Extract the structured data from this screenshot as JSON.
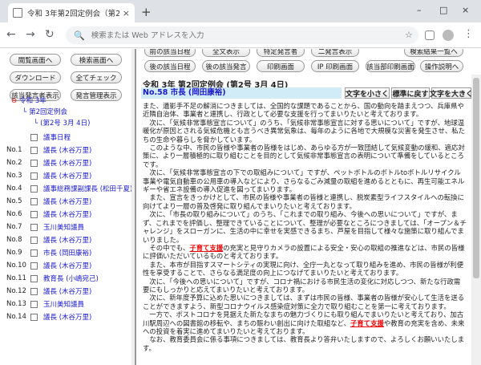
{
  "browser": {
    "tab_title": "令和 3年第2回定例会（第2号 3月",
    "close": "×",
    "newtab": "+",
    "win_min": "–",
    "win_max": "□",
    "win_close": "×",
    "back": "←",
    "forward": "→",
    "reload": "↻",
    "omni_icon": "🔍",
    "address_placeholder": "検索または Web アドレスを入力",
    "star": "☆",
    "menu": "⋮"
  },
  "left": {
    "buttons": [
      "閲覧画面へ",
      "検索画面へ",
      "ダウンロード",
      "全てチェック",
      "該当発言者表示",
      "発言管理表示"
    ],
    "tree_root": "令和 3年",
    "tree_session": "第2回定例会",
    "tree_issue": "(第2号 3月 4日)",
    "tree_line": "└",
    "tree_bullet": "⊖",
    "rows": [
      {
        "no": "",
        "label": "議事日程"
      },
      {
        "no": "No.1",
        "label": "議長 (木谷万里)"
      },
      {
        "no": "No.2",
        "label": "議長 (木谷万里)"
      },
      {
        "no": "No.3",
        "label": "議長 (木谷万里)"
      },
      {
        "no": "No.4",
        "label": "議事総務課副課長 (松田千夏)"
      },
      {
        "no": "No.5",
        "label": "議長 (木谷万里)"
      },
      {
        "no": "No.6",
        "label": "議長 (木谷万里)"
      },
      {
        "no": "No.7",
        "label": "玉川美知議員"
      },
      {
        "no": "No.8",
        "label": "議長 (木谷万里)"
      },
      {
        "no": "No.9",
        "label": "市長 (岡田康裕)"
      },
      {
        "no": "No.10",
        "label": "議長 (木谷万里)"
      },
      {
        "no": "No.11",
        "label": "教育長 (小嶋宛己)"
      },
      {
        "no": "No.12",
        "label": "議長 (木谷万里)"
      },
      {
        "no": "No.13",
        "label": "玉川美知議員"
      },
      {
        "no": "No.14",
        "label": "議長 (木谷万里)"
      }
    ]
  },
  "right": {
    "toolbar": [
      "前の該当日程",
      "全文表示",
      "特定発言者",
      "二発言表示",
      "検索結果一覧へ",
      "後の該当日程",
      "後の該当発言",
      "印刷画面",
      "IP 印刷画面",
      "該当部印刷画面",
      "操作説明へ"
    ],
    "meeting_title": "令和 3年 第2回定例会 (第2号 3月 4日)",
    "speaker": "No.58 市長 (岡田康裕)",
    "size_small": "文字を小さく",
    "size_normal": "標準に戻す",
    "size_large": "文字を大きく",
    "paragraphs": [
      "また、遺影手不足の解消につきましては、全国的な課題であることから、国の動向を踏まえつつ、兵庫県や近隣自治体、事業者と連携し、行政として必要な支援を行ってまいりたいと考えております。",
      "次に、「気候非常事態宣言について」のうち、「気候非常事態宣言に対する思いについて」ですが、地球温暖化が原因とされる気候危機とも言うべき異常気象は、毎年のように各地で大規模な災害を発生させ、私たちの生命や暮らしを脅かしています。",
      "このような中、市民の皆様や事業者の皆様をはじめ、あらゆる方が一致団結して気候変動の緩和、適応対策に、より一層積極的に取り組むことを目的として気候非常事態宣言の表明について準備をしているところです。",
      "次に、「気候非常事態宣言の下での取組みについて」ですが、ペットボトルのボトルtoボトルリサイクル事業や電気自動車の公用車の導入などにより、さらなるごみ減量の取組を進めるとともに、再生可能エネルギーや省エネ設備の導入促進を図ってまいります。",
      "また、宣言をきっかけとして、市民の皆様や事業者の皆様と連携し、脱炭素型ライフスタイルへの転換に向けてより一層の普及啓発に取り組んでまいりたいと考えております。",
      "次に、「市長の取り組みについて」のうち、「これまでの取り組み、今後への思いについて」ですが、まず、これまでを評価し、整理できていることについて、整理が必要なところにつきましては、「オープン＆チャレンジ」をスローガンに、生活の中に幸せを実感できるまち、芦屋を目指して様々な施策に取り組んでまいりました。",
      "その中でも、子育て支援の充実と見守りカメラの設置による安全・安心の取組の推進などは、市民の皆様に評価いただいているものと考えております。",
      "また、本市が目指すスマートシティの実現に向け、全庁一丸となって取り組みを進め、市民の皆様が利便性を享受することで、さらなる満足度の向上につなげてまいりたいと考えております。",
      "次に、「今後への思いについて」ですが、コロナ禍における市民生活の変化に対応しつつ、新たな行政需要にもしっかりと応えてまいりたいと考えております。",
      "次に、新年度予算に込めた思いにつきましては、まずは市民の皆様、事業者の皆様が安心して生活を送ることができますよう、新型コロナウイルス感染症対策に全力で取り組むことを第一に考えております。",
      "一方で、ポストコロナを見据えた新たなまちの魅力づくりにも取り組んでまいりたいと考えており、加古川駅周辺への図書館の移転や、まちの賑わい創出に向けた取組など、子育て支援や教育の充実を含め、未来への投資を着実に進めてまいりたいと考えております。",
      "なお、教育委員会に係る事項につきましては、教育長より答弁いたしますので、よろしくお願いいたします。"
    ]
  }
}
